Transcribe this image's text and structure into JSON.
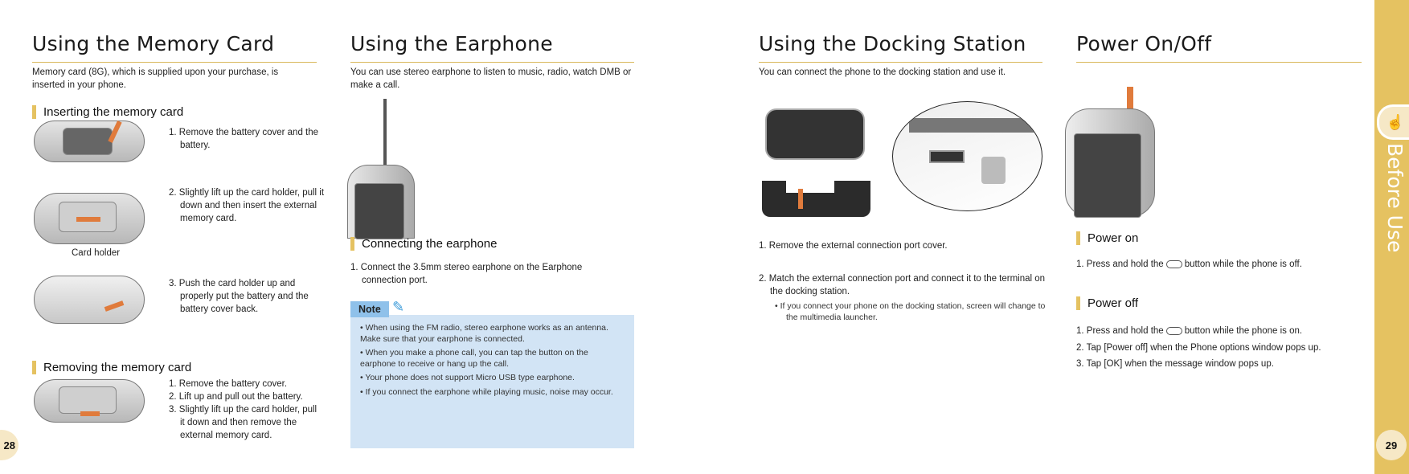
{
  "memory": {
    "title": "Using the Memory Card",
    "intro": "Memory card (8G), which is supplied upon your purchase, is inserted in your phone.",
    "insert_heading": "Inserting the memory card",
    "insert_steps": [
      "1. Remove the battery cover and the battery.",
      "2. Slightly lift up the card holder, pull it down and then insert the external memory card.",
      "3. Push the card holder up and properly put the battery and the battery cover back."
    ],
    "card_holder_label": "Card holder",
    "remove_heading": "Removing the memory card",
    "remove_steps": [
      "1. Remove the battery cover.",
      "2. Lift up and pull out the battery.",
      "3. Slightly lift up the card holder, pull it down and then remove the external memory card."
    ]
  },
  "earphone": {
    "title": "Using the Earphone",
    "intro": "You can use stereo earphone to listen to music, radio, watch DMB or make a call.",
    "heading": "Connecting the earphone",
    "step": "1. Connect the 3.5mm stereo earphone on the Earphone connection port.",
    "note_label": "Note",
    "notes": [
      "• When using the FM radio, stereo earphone works as an antenna. Make sure that your earphone is connected.",
      "• When you make a phone call, you can tap the button on the earphone to receive or hang up the call.",
      "• Your phone does not support Micro USB type earphone.",
      "• If you connect the earphone while playing music, noise may occur."
    ]
  },
  "docking": {
    "title": "Using the Docking Station",
    "intro": "You can connect the phone to the docking station and use it.",
    "step1": "1.  Remove the external connection port cover.",
    "step2": "2. Match the external connection port and connect it to the terminal on the docking station.",
    "bullet": "• If you connect your phone on the docking station, screen will change to the multimedia launcher."
  },
  "power": {
    "title": "Power On/Off",
    "on_heading": "Power on",
    "on_step_a": "1. Press and hold the",
    "on_step_b": "button while the phone is off.",
    "off_heading": "Power off",
    "off_step1_a": "1. Press and hold the",
    "off_step1_b": "button while the phone is on.",
    "off_step2": "2. Tap [Power off] when the Phone options window pops up.",
    "off_step3": "3. Tap [OK] when the message window pops up."
  },
  "side_tab": {
    "label": "Before Use",
    "icon": "hand-pointing-icon"
  },
  "pages": {
    "left": "28",
    "right": "29"
  },
  "colors": {
    "accent": "#e5c261",
    "note_bg": "#d2e4f5",
    "arrow": "#e07b3c"
  }
}
